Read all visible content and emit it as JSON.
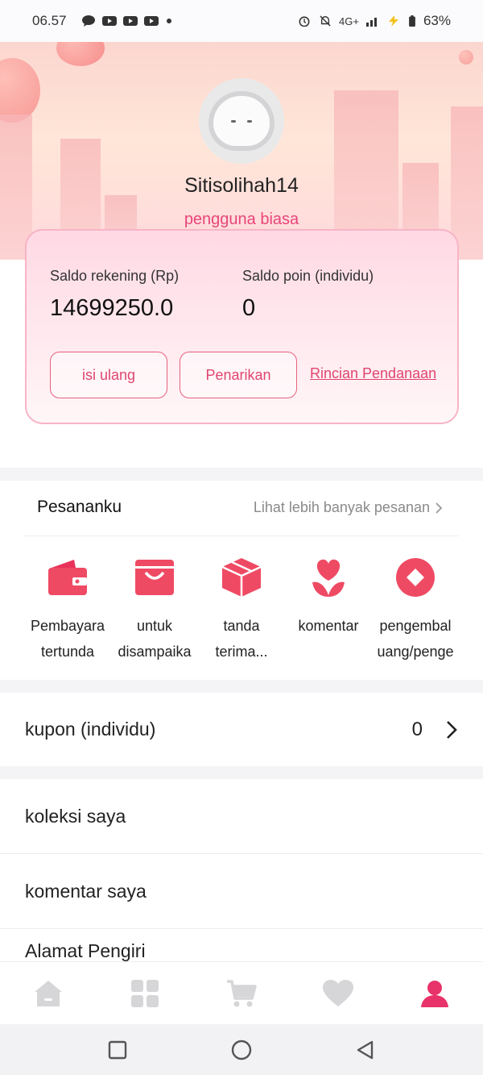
{
  "status_bar": {
    "time": "06.57",
    "network": "4G+",
    "battery": "63%",
    "left_icons": [
      "chat-bubble-icon",
      "youtube-icon",
      "youtube-icon",
      "youtube-icon",
      "dot-icon"
    ],
    "right_icons": [
      "alarm-icon",
      "mute-icon",
      "signal-icon",
      "charging-icon",
      "battery-icon"
    ]
  },
  "profile": {
    "username": "Sitisolihah14",
    "level": "pengguna biasa"
  },
  "balance": {
    "account_label": "Saldo rekening (Rp)",
    "account_value": "14699250.0",
    "points_label": "Saldo poin (individu)",
    "points_value": "0",
    "topup_label": "isi ulang",
    "withdraw_label": "Penarikan",
    "details_link": "Rincian Pendanaan"
  },
  "orders": {
    "title": "Pesananku",
    "more": "Lihat lebih banyak pesanan",
    "items": [
      {
        "line1": "Pembayara",
        "line2": "tertunda",
        "icon": "wallet-icon"
      },
      {
        "line1": "untuk",
        "line2": "disampaika",
        "icon": "shopping-bag-icon"
      },
      {
        "line1": "tanda",
        "line2": "terima...",
        "icon": "package-icon"
      },
      {
        "line1": "komentar",
        "line2": "",
        "icon": "flower-icon"
      },
      {
        "line1": "pengembal",
        "line2": "uang/penge",
        "icon": "refund-icon"
      }
    ]
  },
  "menu": {
    "coupon_label": "kupon (individu)",
    "coupon_count": "0",
    "collection": "koleksi saya",
    "reviews": "komentar saya",
    "address_partial": "Alamat Pengiri"
  },
  "nav": {
    "items": [
      "home-icon",
      "grid-icon",
      "cart-icon",
      "heart-icon",
      "profile-icon"
    ],
    "active": "profile-icon",
    "active_color": "#e8326a",
    "inactive_color": "#d6d6d8"
  },
  "accent_color": "#e8457a"
}
